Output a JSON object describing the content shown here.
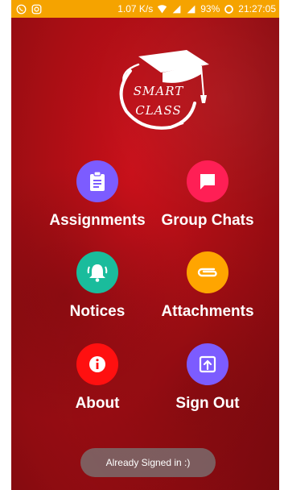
{
  "status_bar": {
    "speed": "1.07 K/s",
    "battery": "93%",
    "time": "21:27:05"
  },
  "logo": {
    "line1": "SMART",
    "line2": "CLASS"
  },
  "menu": {
    "assignments": "Assignments",
    "group_chats": "Group Chats",
    "notices": "Notices",
    "attachments": "Attachments",
    "about": "About",
    "sign_out": "Sign Out"
  },
  "toast": "Already Signed in :)",
  "colors": {
    "status_bar": "#f5a300",
    "background": "#a80e14",
    "assignments": "#7c5cff",
    "group_chats": "#ff1f55",
    "notices": "#1abc9c",
    "attachments": "#ffa500",
    "about": "#ff1010",
    "sign_out": "#7c5cff"
  }
}
